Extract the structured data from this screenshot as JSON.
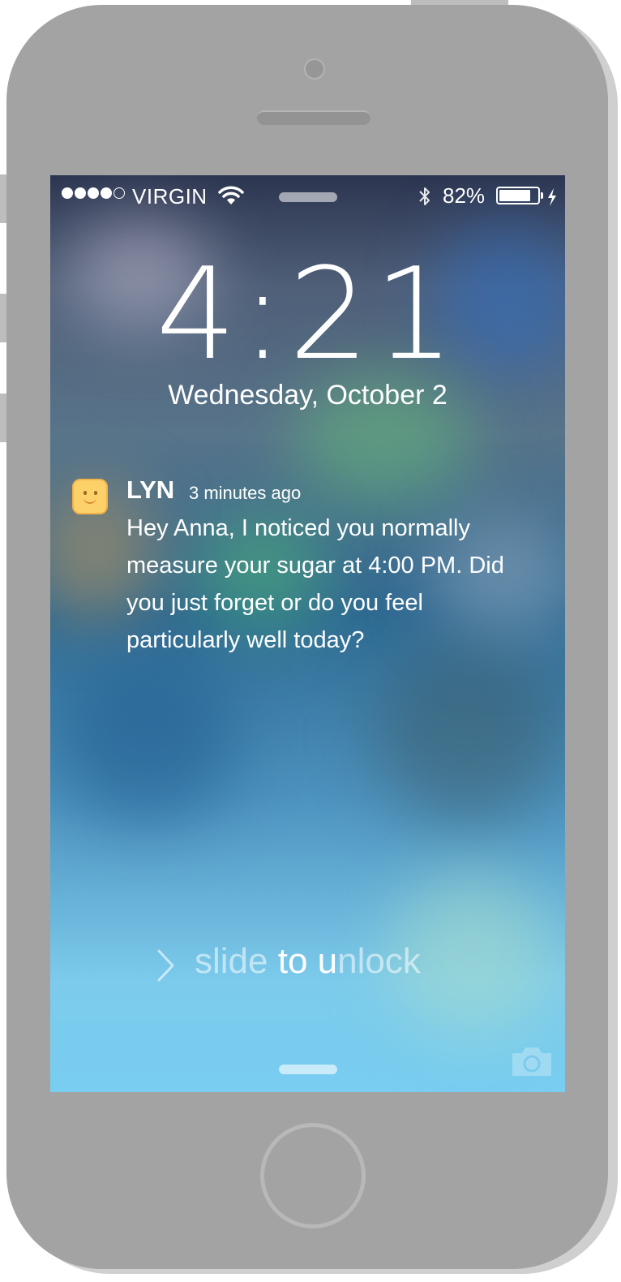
{
  "status_bar": {
    "signal_bars_filled": 4,
    "signal_bars_total": 5,
    "carrier": "VIRGIN",
    "battery_percent": "82%",
    "battery_level": 0.82,
    "icons": [
      "wifi-icon",
      "bluetooth-icon",
      "battery-icon",
      "charging-bolt-icon"
    ]
  },
  "lock_screen": {
    "time": "4:21",
    "date": "Wednesday, October 2"
  },
  "notification": {
    "app_name": "LYN",
    "timestamp": "3 minutes ago",
    "message": "Hey Anna, I noticed you normally measure your sugar at 4:00 PM. Did you just forget or do you feel particularly well today?",
    "icon": "smiley-face-icon"
  },
  "unlock": {
    "slide_1": "slide",
    "slide_2": " to u",
    "slide_3": "nlock"
  },
  "colors": {
    "phone_body": "#a3a3a3",
    "app_icon": "#fdd16a"
  }
}
